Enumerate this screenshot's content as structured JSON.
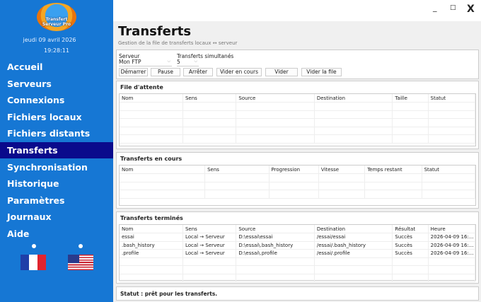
{
  "app": {
    "logo_text": "Transfert Serveur Pro",
    "date": "jeudi 09 avril 2026",
    "time": "19:28:11"
  },
  "window": {
    "minimize": "_",
    "maximize": "□",
    "close": "X"
  },
  "sidebar": {
    "items": [
      {
        "label": "Accueil"
      },
      {
        "label": "Serveurs"
      },
      {
        "label": "Connexions"
      },
      {
        "label": "Fichiers locaux"
      },
      {
        "label": "Fichiers distants"
      },
      {
        "label": "Transferts",
        "selected": true
      },
      {
        "label": "Synchronisation"
      },
      {
        "label": "Historique"
      },
      {
        "label": "Paramètres"
      },
      {
        "label": "Journaux"
      },
      {
        "label": "Aide"
      }
    ],
    "languages": [
      "fr",
      "us"
    ]
  },
  "page": {
    "title": "Transferts",
    "subtitle": "Gestion de la file de transferts locaux ↔ serveur"
  },
  "controls": {
    "server_label": "Serveur",
    "server_value": "Mon FTP",
    "concurrent_label": "Transferts simultanés",
    "concurrent_value": "5",
    "buttons": [
      "Démarrer",
      "Pause",
      "Arrêter",
      "Vider en cours",
      "Vider",
      "Vider la file"
    ]
  },
  "queue": {
    "title": "File d'attente",
    "columns": [
      "Nom",
      "Sens",
      "Source",
      "Destination",
      "Taille",
      "Statut"
    ],
    "rows": []
  },
  "in_progress": {
    "title": "Transferts en cours",
    "columns": [
      "Nom",
      "Sens",
      "Progression",
      "Vitesse",
      "Temps restant",
      "Statut"
    ],
    "rows": []
  },
  "completed": {
    "title": "Transferts terminés",
    "columns": [
      "Nom",
      "Sens",
      "Source",
      "Destination",
      "Résultat",
      "Heure"
    ],
    "rows": [
      [
        "essai",
        "Local → Serveur",
        "D:\\essai\\essai",
        "/essai/essai",
        "Succès",
        "2026-04-09 16:..."
      ],
      [
        ".bash_history",
        "Local → Serveur",
        "D:\\essai\\.bash_history",
        "/essai/.bash_history",
        "Succès",
        "2026-04-09 16:..."
      ],
      [
        ".profile",
        "Local → Serveur",
        "D:\\essai\\.profile",
        "/essai/.profile",
        "Succès",
        "2026-04-09 16:..."
      ]
    ]
  },
  "status": "Statut : prêt pour les transferts."
}
